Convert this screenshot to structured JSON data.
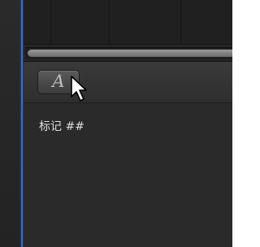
{
  "toolbar": {
    "text_style_button_glyph": "A"
  },
  "marker": {
    "label": "标记 ##"
  },
  "colors": {
    "playhead": "#3468d9",
    "background": "#262626"
  },
  "icons": {
    "cursor": "arrow-pointer-icon"
  }
}
